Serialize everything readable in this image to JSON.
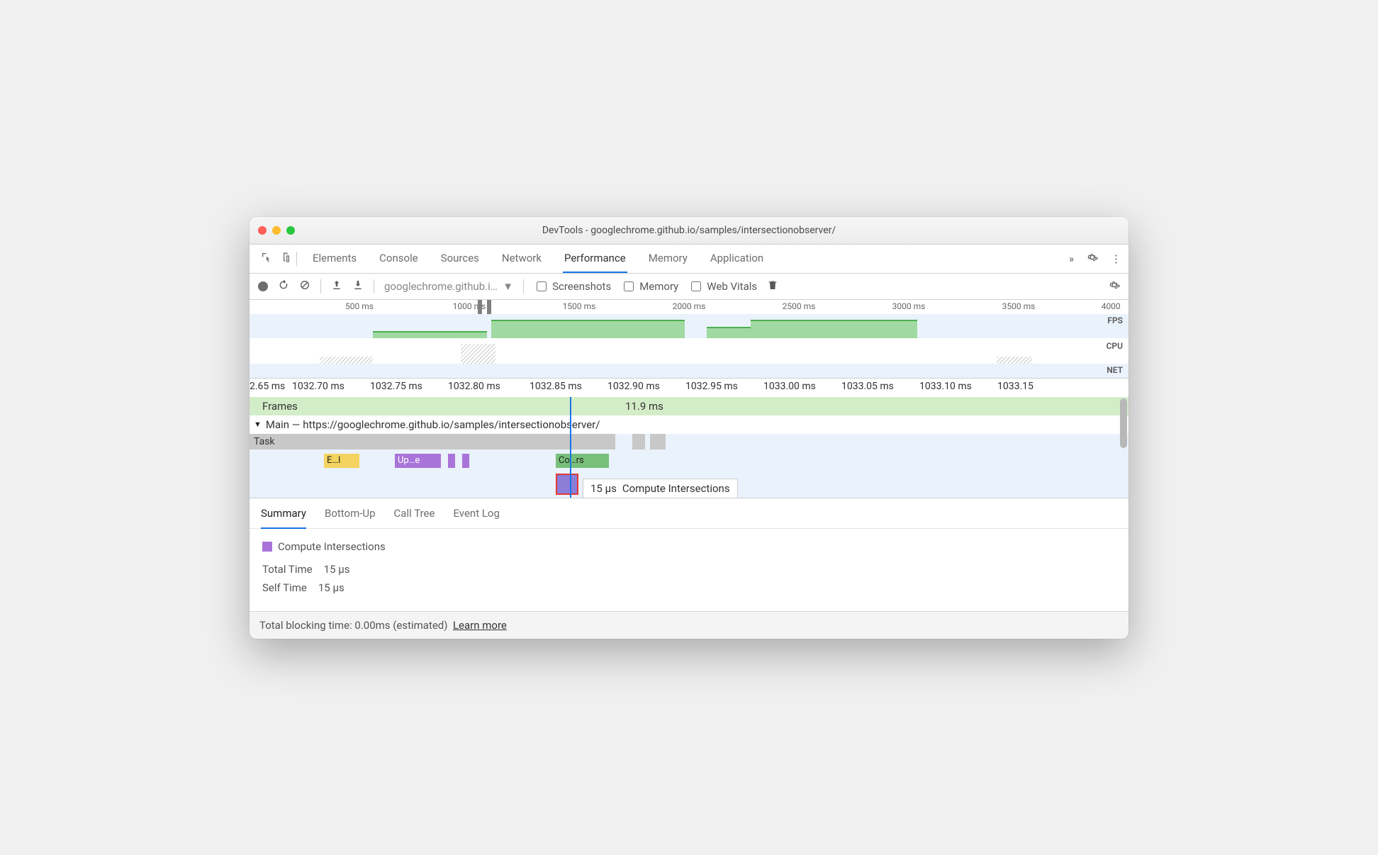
{
  "window": {
    "title": "DevTools - googlechrome.github.io/samples/intersectionobserver/"
  },
  "mainTabs": [
    "Elements",
    "Console",
    "Sources",
    "Network",
    "Performance",
    "Memory",
    "Application"
  ],
  "activeTab": "Performance",
  "toolbar": {
    "dropdown": "googlechrome.github.i…",
    "screenshots": "Screenshots",
    "memory": "Memory",
    "webvitals": "Web Vitals"
  },
  "overview": {
    "ticks": [
      "500 ms",
      "1000 ms",
      "1500 ms",
      "2000 ms",
      "2500 ms",
      "3000 ms",
      "3500 ms",
      "4000 ms"
    ],
    "labels": {
      "fps": "FPS",
      "cpu": "CPU",
      "net": "NET"
    }
  },
  "detail": {
    "ruler": [
      "2.65 ms",
      "1032.70 ms",
      "1032.75 ms",
      "1032.80 ms",
      "1032.85 ms",
      "1032.90 ms",
      "1032.95 ms",
      "1033.00 ms",
      "1033.05 ms",
      "1033.10 ms",
      "1033.15"
    ],
    "framesLabel": "Frames",
    "framesValue": "11.9 ms",
    "mainLabel": "Main — https://googlechrome.github.io/samples/intersectionobserver/",
    "taskLabel": "Task",
    "blocks": {
      "e": "E…l",
      "up": "Up…e",
      "co": "Co…rs"
    },
    "tooltip": {
      "time": "15 µs",
      "name": "Compute Intersections"
    }
  },
  "bottomTabs": [
    "Summary",
    "Bottom-Up",
    "Call Tree",
    "Event Log"
  ],
  "summary": {
    "title": "Compute Intersections",
    "totalLabel": "Total Time",
    "totalValue": "15 µs",
    "selfLabel": "Self Time",
    "selfValue": "15 µs"
  },
  "footer": {
    "text": "Total blocking time: 0.00ms (estimated)",
    "link": "Learn more"
  }
}
